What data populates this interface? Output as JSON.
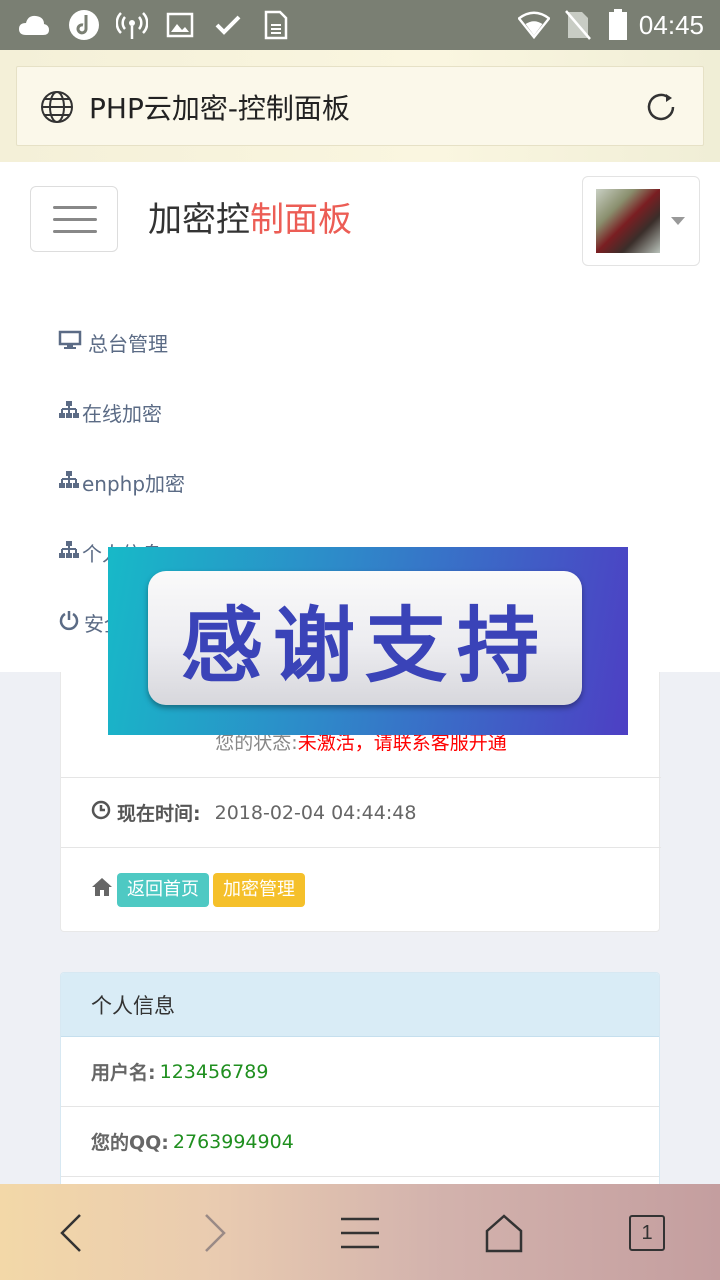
{
  "status_bar": {
    "time": "04:45",
    "icons": [
      "cloud-icon",
      "music-icon",
      "hotspot-icon",
      "image-icon",
      "check-icon",
      "sim-card-icon",
      "wifi-icon",
      "no-sim-icon",
      "battery-icon"
    ]
  },
  "browser": {
    "page_title": "PHP云加密-控制面板",
    "tab_count": "1"
  },
  "header": {
    "brand_part1": "加密控",
    "brand_part2": "制面板"
  },
  "menu": {
    "items": [
      {
        "label": "总台管理",
        "icon": "desktop-icon"
      },
      {
        "label": "在线加密",
        "icon": "sitemap-icon"
      },
      {
        "label": "enphp加密",
        "icon": "sitemap-icon"
      },
      {
        "label": "个人信息",
        "icon": "sitemap-icon"
      },
      {
        "label": "安全退出",
        "icon": "power-icon"
      }
    ]
  },
  "overlay": {
    "text": "感谢支持"
  },
  "status_card": {
    "status_label": "您的状态:",
    "status_value": "未激活，请联系客服开通",
    "time_label": "现在时间:",
    "time_value": "2018-02-04 04:44:48",
    "home_button": "返回首页",
    "manage_button": "加密管理"
  },
  "info_card": {
    "heading": "个人信息",
    "username_label": "用户名:",
    "username_value": "123456789",
    "qq_label": "您的QQ:",
    "qq_value": "2763994904"
  },
  "colors": {
    "brand_accent": "#ec5d55",
    "status_red": "#ff0000",
    "value_green": "#1f8f1f",
    "home_btn": "#4ec9c3",
    "manage_btn": "#f5c02a"
  }
}
